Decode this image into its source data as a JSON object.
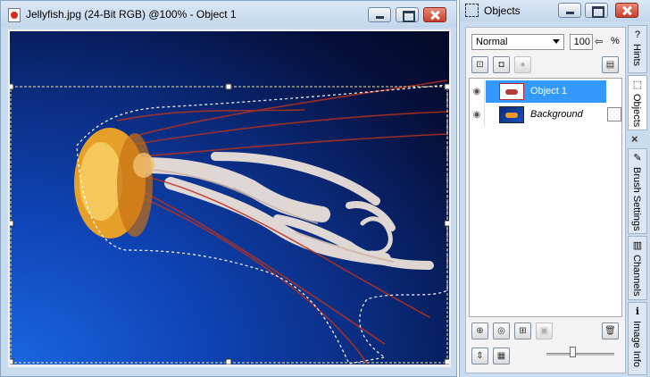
{
  "document_window": {
    "title": "Jellyfish.jpg (24-Bit RGB) @100% - Object 1",
    "file_icon": "document-image-icon",
    "controls": {
      "minimize": "minimize-icon",
      "maximize": "maximize-icon",
      "close": "close-icon"
    }
  },
  "canvas": {
    "image": "jellyfish-photo",
    "selection": "object-1-marquee"
  },
  "objects_panel": {
    "title": "Objects",
    "title_icon": "objects-marquee-icon",
    "blend_mode": "Normal",
    "opacity": "100",
    "opacity_spin": "⇦",
    "opacity_unit": "%",
    "layers": [
      {
        "name": "Object 1",
        "visible_icon": "eye-icon",
        "selected": true,
        "italic": false
      },
      {
        "name": "Background",
        "visible_icon": "eye-icon",
        "selected": false,
        "italic": true
      }
    ],
    "top_tools": [
      "lock-icon",
      "lock-transparency-icon",
      "lock-all-icon",
      "properties-icon"
    ],
    "bottom_tools": [
      "new-object-icon",
      "new-lens-icon",
      "new-from-selection-icon",
      "combine-icon",
      "delete-icon"
    ],
    "footer_tools": [
      "fit-icon",
      "thumbnail-size-icon"
    ]
  },
  "dock_tabs": [
    {
      "label": "Hints",
      "icon": "hints-icon",
      "active": false
    },
    {
      "label": "Objects",
      "icon": "objects-tab-icon",
      "active": true
    },
    {
      "label": "Brush Settings",
      "icon": "brush-icon",
      "active": false
    },
    {
      "label": "Channels",
      "icon": "channels-icon",
      "active": false
    },
    {
      "label": "Image Info",
      "icon": "info-icon",
      "active": false
    }
  ],
  "dock_close": "×",
  "colors": {
    "chrome": "#c9dcee",
    "selection": "#3399ff",
    "close_button": "#c6402d"
  }
}
